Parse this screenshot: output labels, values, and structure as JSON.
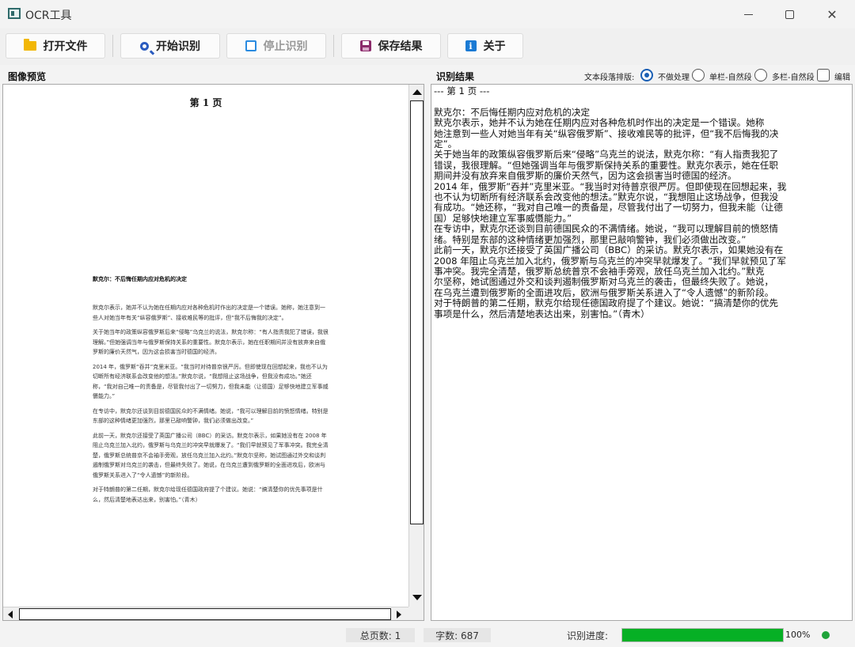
{
  "window": {
    "title": "OCR工具",
    "minimize_icon": "minimize-icon",
    "maximize_icon": "maximize-icon",
    "close_icon": "close-icon"
  },
  "toolbar": {
    "open_file": "打开文件",
    "start_ocr": "开始识别",
    "stop_ocr": "停止识别",
    "save_result": "保存结果",
    "about": "关于"
  },
  "preview": {
    "header": "图像预览",
    "page_title": "第 1 页",
    "heading": "默克尔：不后悔任期内应对危机的决定",
    "paragraphs": [
      "默克尔表示，她并不认为她在任期内应对各种危机时作出的决定是一个错误。她称，她注意到一些人对她当年有关“纵容俄罗斯”、接收难民等的批评，但“我不后悔我的决定”。",
      "关于她当年的政策纵容俄罗斯后来“侵略”乌克兰的说法，默克尔称：“有人指责我犯了错误，我很理解。”但她强调当年与俄罗斯保持关系的重要性。默克尔表示，她在任职期间并没有放弃来自俄罗斯的廉价天然气，因为这会损害当时德国的经济。",
      "2014 年，俄罗斯“吞并”克里米亚。“我当时对待普京很严厉。但即使现在回想起来，我也不认为切断所有经济联系会改变他的想法。”默克尔说，“我想阻止这场战争，但我没有成功。”她还称，“我对自己唯一的责备是，尽管我付出了一切努力，但我未能（让德国）足够快地建立军事威慑能力。”",
      "在专访中，默克尔还谈到目前德国民众的不满情绪。她说，“我可以理解目前的愤怒情绪。特别是东部的这种情绪更加强烈，那里已敲响警钟，我们必须做出改变。”",
      "此前一天，默克尔还接受了英国广播公司（BBC）的采访。默克尔表示，如果她没有在 2008 年阻止乌克兰加入北约，俄罗斯与乌克兰的冲突早就爆发了。“我们早就预见了军事冲突。我完全清楚，俄罗斯总统普京不会袖手旁观，放任乌克兰加入北约。”默克尔坚称，她试图通过外交和谈判遏制俄罗斯对乌克兰的袭击，但最终失败了。她说，在乌克兰遭到俄罗斯的全面进攻后，欧洲与俄罗斯关系进入了“令人遗憾”的新阶段。",
      "对于特朗普的第二任期，默克尔给现任德国政府提了个建议。她说：“搞清楚你的优先事项是什么，然后清楚地表达出来，别害怕。”（青木）"
    ]
  },
  "result": {
    "header": "识别结果",
    "layout_label": "文本段落排版:",
    "options": [
      "不做处理",
      "单栏-自然段",
      "多栏-自然段"
    ],
    "selected_option": "不做处理",
    "edit_label": "编辑",
    "edit_checked": false,
    "text": "--- 第 1 页 ---\n\n默克尔：不后悔任期内应对危机的决定\n默克尔表示，她并不认为她在任期内应对各种危机时作出的决定是一个错误。她称\n她注意到一些人对她当年有关“纵容俄罗斯”、接收难民等的批评，但“我不后悔我的决\n定”。\n关于她当年的政策纵容俄罗斯后来“侵略”乌克兰的说法，默克尔称：“有人指责我犯了\n错误，我很理解。“但她强调当年与俄罗斯保持关系的重要性。默克尔表示，她在任职\n期间并没有放弃来自俄罗斯的廉价天然气，因为这会损害当时德国的经济。\n2014 年，俄罗斯”吞并”克里米亚。“我当时对待普京很严厉。但即使现在回想起来，我\n也不认为切断所有经济联系会改变他的想法。”默克尔说，“我想阻止这场战争，但我没\n有成功。“她还称，“我对自己唯一的责备是，尽管我付出了一切努力，但我未能（让德\n国）足够快地建立军事威慑能力。”\n在专访中，默克尔还谈到目前德国民众的不满情绪。她说，“我可以理解目前的愤怒情\n绪。特别是东部的这种情绪更加强烈，那里已敲响警钟，我们必须做出改变。”\n此前一天，默克尔还接受了英国广播公司（BBC）的采访。默克尔表示，如果她没有在\n2008 年阻止乌克兰加入北约，俄罗斯与乌克兰的冲突早就爆发了。“我们早就预见了军\n事冲突。我完全清楚，俄罗斯总统普京不会袖手旁观，放任乌克兰加入北约。”默克\n尔坚称，她试图通过外交和谈判遏制俄罗斯对乌克兰的袭击，但最终失败了。她说，\n在乌克兰遭到俄罗斯的全面进攻后，欧洲与俄罗斯关系进入了“令人遗憾”的新阶段。\n对于特朗普的第二任期，默克尔给现任德国政府提了个建议。她说：“搞清楚你的优先\n事项是什么，然后清楚地表达出来，别害怕。”（青木）"
  },
  "status": {
    "total_pages": "总页数: 1",
    "char_count": "字数: 687",
    "progress_label": "识别进度:",
    "progress_percent": 100,
    "progress_text": "100%",
    "progress_color": "#06b025",
    "indicator_color": "#1fa33a"
  }
}
